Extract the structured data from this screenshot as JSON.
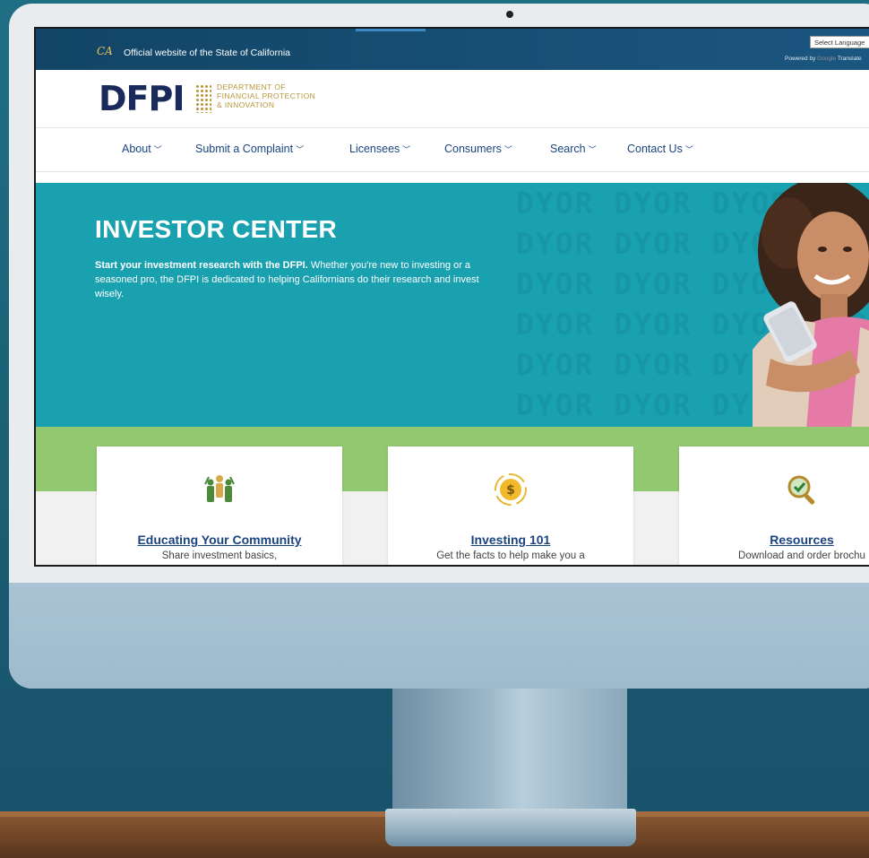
{
  "gov_bar": {
    "ca_logo": "CA.GOV",
    "official_text": "Official website of the State of California",
    "language_select": "Select Language",
    "powered_by": "Powered by",
    "google": "Google",
    "translate": "Translate"
  },
  "header": {
    "logo_text": "DFPI",
    "department_line1": "DEPARTMENT OF",
    "department_line2": "FINANCIAL PROTECTION",
    "department_line3": "& INNOVATION"
  },
  "nav": {
    "items": [
      {
        "label": "About"
      },
      {
        "label": "Submit a Complaint"
      },
      {
        "label": "Licensees"
      },
      {
        "label": "Consumers"
      },
      {
        "label": "Search"
      },
      {
        "label": "Contact Us"
      }
    ]
  },
  "hero": {
    "title": "INVESTOR CENTER",
    "lead_bold": "Start your investment research with the DFPI.",
    "lead_rest": " Whether you're new to investing or a seasoned pro, the DFPI is dedicated to helping Californians do their research and invest wisely.",
    "background_word": "DYOR"
  },
  "cards": [
    {
      "title": "Educating Your Community",
      "desc": "Share investment basics,",
      "icon": "community-people-icon"
    },
    {
      "title": "Investing 101",
      "desc": "Get the facts to help make you a",
      "icon": "dollar-coin-icon"
    },
    {
      "title": "Resources",
      "desc": "Download and order brochu",
      "icon": "magnifier-check-icon"
    }
  ],
  "colors": {
    "gov_bar": "#124566",
    "nav_text": "#1a4480",
    "hero_bg": "#1aa1b0",
    "green_band": "#92c870",
    "logo_navy": "#1a2a5a",
    "logo_gold": "#b8963a"
  }
}
